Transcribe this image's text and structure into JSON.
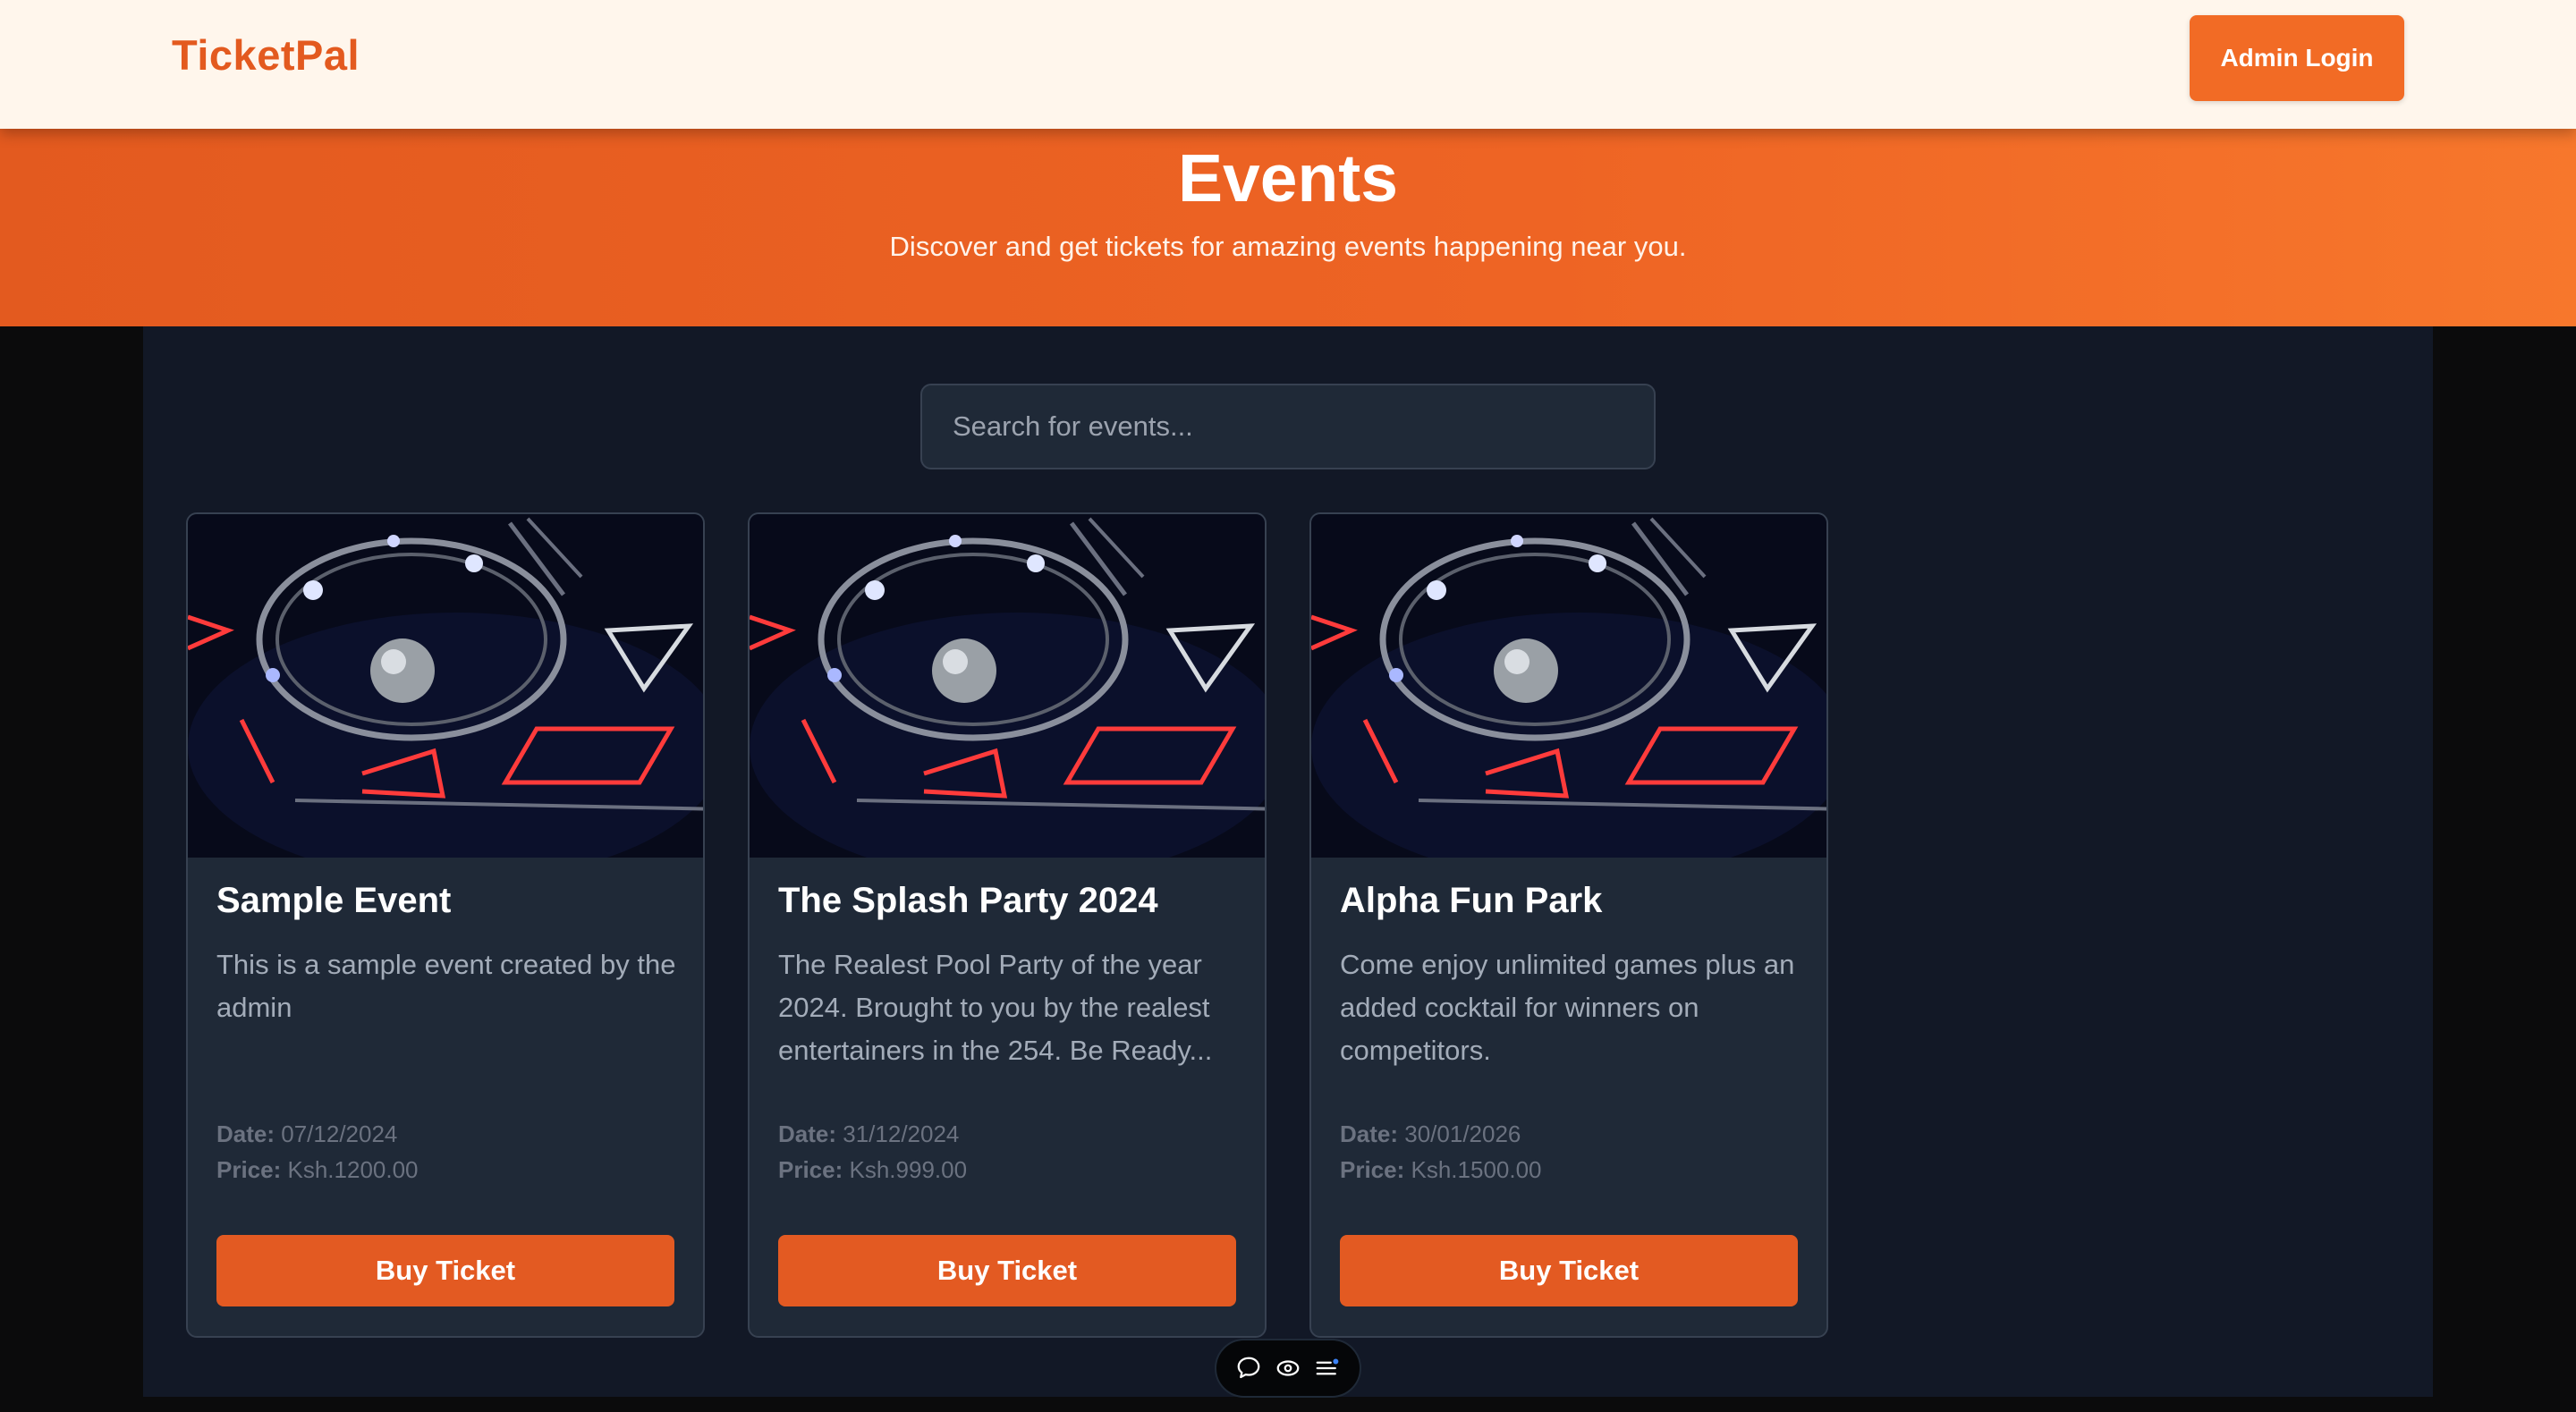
{
  "navbar": {
    "brand": "TicketPal",
    "admin_login_label": "Admin Login"
  },
  "hero": {
    "title": "Events",
    "subtitle": "Discover and get tickets for amazing events happening near you."
  },
  "search": {
    "placeholder": "Search for events...",
    "value": ""
  },
  "events": [
    {
      "title": "Sample Event",
      "description": "This is a sample event created by the admin",
      "date_label": "Date:",
      "date": "07/12/2024",
      "price_label": "Price:",
      "price": "Ksh.1200.00",
      "button_label": "Buy Ticket"
    },
    {
      "title": "The Splash Party 2024",
      "description": "The Realest Pool Party of the year 2024. Brought to you by the realest entertainers in the 254. Be Ready...",
      "date_label": "Date:",
      "date": "31/12/2024",
      "price_label": "Price:",
      "price": "Ksh.999.00",
      "button_label": "Buy Ticket"
    },
    {
      "title": "Alpha Fun Park",
      "description": "Come enjoy unlimited games plus an added cocktail for winners on competitors.",
      "date_label": "Date:",
      "date": "30/01/2026",
      "price_label": "Price:",
      "price": "Ksh.1500.00",
      "button_label": "Buy Ticket"
    }
  ],
  "toolbar": {
    "icons": [
      "chat-icon",
      "eye-icon",
      "menu-icon"
    ]
  },
  "colors": {
    "brand": "#e35a1f",
    "accent": "#f26b25",
    "background": "#121826",
    "card": "#1f2937"
  }
}
